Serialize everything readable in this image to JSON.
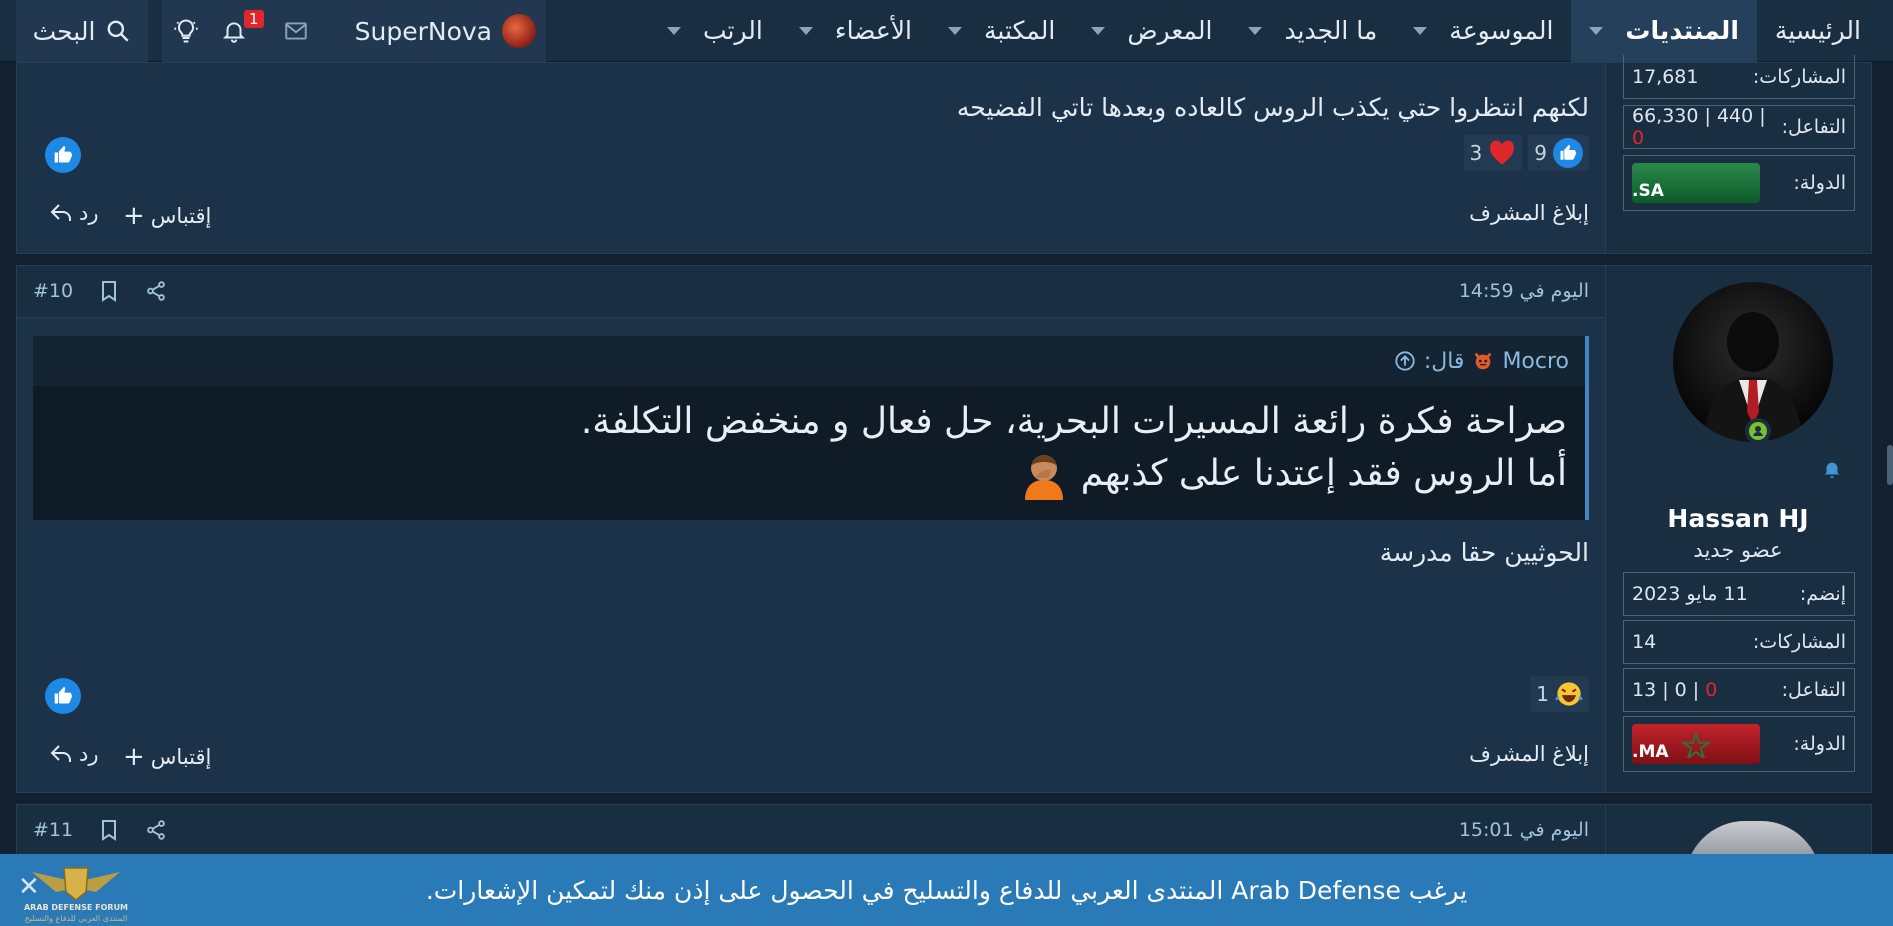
{
  "nav": {
    "home": "الرئيسية",
    "forums": "المنتديات",
    "encyclopedia": "الموسوعة",
    "whats_new": "ما الجديد",
    "gallery": "المعرض",
    "library": "المكتبة",
    "members": "الأعضاء",
    "ranks": "الرتب",
    "username": "SuperNova",
    "notification_count": "1",
    "search": "البحث"
  },
  "post9": {
    "posts_label": "المشاركات:",
    "posts_value": "17,681",
    "interaction_label": "التفاعل:",
    "interaction_value": "66,330 | 440 | ",
    "interaction_neg": "0",
    "country_label": "الدولة:",
    "flag_code": "SA.",
    "body": "لكنهم انتظروا حتي يكذب الروس كالعاده وبعدها تاتي الفضيحه",
    "likes": "9",
    "hearts": "3",
    "report": "إبلاغ المشرف",
    "quote": "إقتباس",
    "reply": "رد"
  },
  "post10": {
    "date": "اليوم في 14:59",
    "number": "#10",
    "quote_author": "Mocro",
    "quote_said": "قال:",
    "quote_line1": "صراحة فكرة رائعة المسيرات البحرية، حل فعال و منخفض التكلفة.",
    "quote_line2": "أما الروس فقد إعتدنا على كذبهم",
    "body": "الحوثيين حقا مدرسة",
    "laugh_count": "1",
    "username": "Hassan HJ",
    "user_title": "عضو جديد",
    "joined_label": "إنضم:",
    "joined_value": "11 مايو 2023",
    "posts_label": "المشاركات:",
    "posts_value": "14",
    "interaction_label": "التفاعل:",
    "interaction_value": "13 | 0 | ",
    "interaction_neg": "0",
    "country_label": "الدولة:",
    "flag_code": "MA.",
    "report": "إبلاغ المشرف",
    "quote": "إقتباس",
    "reply": "رد"
  },
  "post11": {
    "date": "اليوم في 15:01",
    "number": "#11"
  },
  "banner": {
    "text": "يرغب Arab Defense المنتدى العربي للدفاع والتسليح في الحصول على إذن منك لتمكين الإشعارات.",
    "logo_text": "ARAB DEFENSE FORUM",
    "logo_subtext": "المنتدى العربي للدفاع والتسليح"
  },
  "colors": {
    "accent": "#1e88e5",
    "negative": "#e0252b",
    "banner": "#2a7ab8"
  }
}
